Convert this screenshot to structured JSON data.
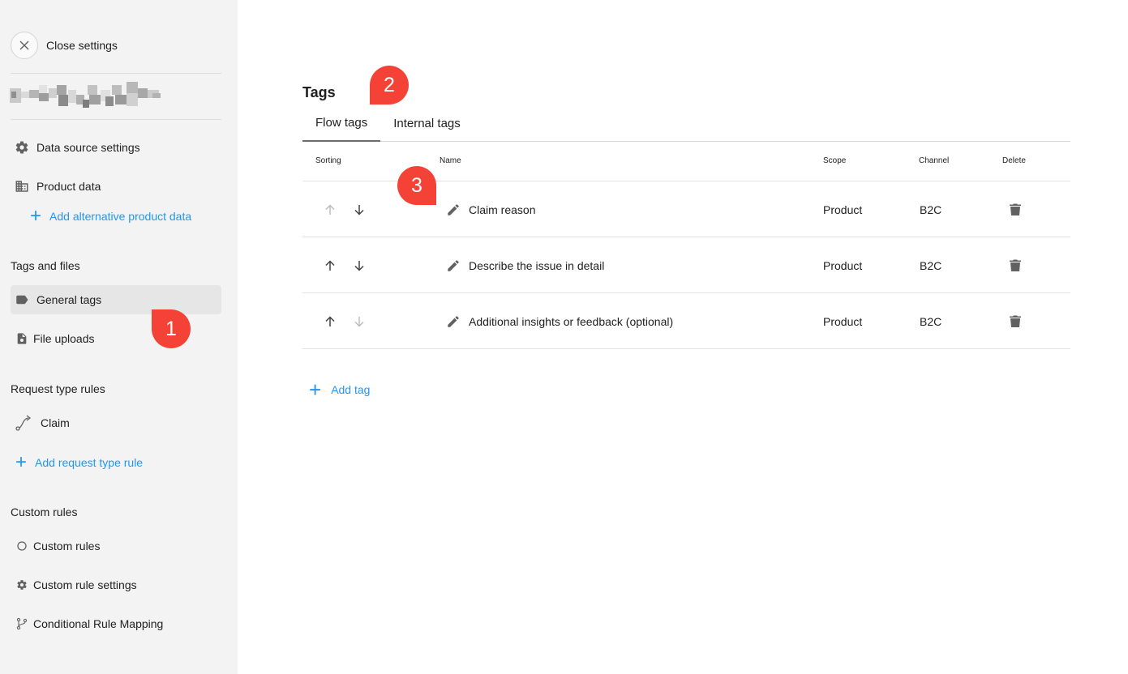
{
  "sidebar": {
    "close_label": "Close settings",
    "data_source_settings": "Data source settings",
    "product_data": "Product data",
    "add_alt_product_data": "Add alternative product data",
    "tags_and_files_title": "Tags and files",
    "general_tags": "General tags",
    "file_uploads": "File uploads",
    "request_type_rules_title": "Request type rules",
    "claim": "Claim",
    "add_request_type_rule": "Add request type rule",
    "custom_rules_title": "Custom rules",
    "custom_rules": "Custom rules",
    "custom_rule_settings": "Custom rule settings",
    "conditional_rule_mapping": "Conditional Rule Mapping"
  },
  "main": {
    "title": "Tags",
    "tabs": [
      "Flow tags",
      "Internal tags"
    ],
    "active_tab": "Flow tags",
    "columns": {
      "sorting": "Sorting",
      "name": "Name",
      "scope": "Scope",
      "channel": "Channel",
      "delete": "Delete"
    },
    "rows": [
      {
        "name": "Claim reason",
        "scope": "Product",
        "channel": "B2C",
        "up_enabled": false,
        "down_enabled": true
      },
      {
        "name": "Describe the issue in detail",
        "scope": "Product",
        "channel": "B2C",
        "up_enabled": true,
        "down_enabled": true
      },
      {
        "name": "Additional insights or feedback (optional)",
        "scope": "Product",
        "channel": "B2C",
        "up_enabled": true,
        "down_enabled": false
      }
    ],
    "add_tag": "Add tag"
  },
  "callouts": [
    "1",
    "2",
    "3"
  ],
  "colors": {
    "accent": "#2196f3",
    "callout": "#f44336",
    "sidebar_bg": "#f3f3f3"
  }
}
